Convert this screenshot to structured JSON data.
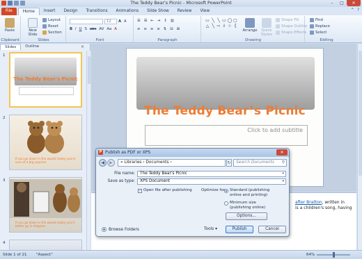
{
  "window": {
    "title": "The Teddy Bear's Picnic - Microsoft PowerPoint",
    "minimize": "–",
    "maximize": "□",
    "close": "✕"
  },
  "tabs": [
    "File",
    "Home",
    "Insert",
    "Design",
    "Transitions",
    "Animations",
    "Slide Show",
    "Review",
    "View"
  ],
  "ribbon": {
    "clipboard": {
      "label": "Clipboard",
      "paste": "Paste"
    },
    "slides": {
      "label": "Slides",
      "new_slide": "New Slide",
      "layout": "Layout",
      "reset": "Reset",
      "section": "Section"
    },
    "font": {
      "label": "Font",
      "size": "12"
    },
    "paragraph": {
      "label": "Paragraph"
    },
    "drawing": {
      "label": "Drawing",
      "arrange": "Arrange",
      "quick_styles": "Quick Styles",
      "shape_fill": "Shape Fill",
      "shape_outline": "Shape Outline",
      "shape_effects": "Shape Effects"
    },
    "editing": {
      "label": "Editing",
      "find": "Find",
      "replace": "Replace",
      "select": "Select"
    }
  },
  "left_pane": {
    "tabs": [
      "Slides",
      "Outline"
    ],
    "close": "×",
    "slides": [
      {
        "number": "1",
        "title": "The Teddy Bear's Picnic"
      },
      {
        "number": "2",
        "caption": "If you go down in the woods today you're sure of a big surprise"
      },
      {
        "number": "3",
        "caption": "If you go down in the woods today you'd better go in disguise"
      },
      {
        "number": "4",
        "caption": ""
      }
    ]
  },
  "slide": {
    "title": "The Teddy Bear’s Picnic",
    "subtitle_placeholder": "Click to add subtitle"
  },
  "notes": {
    "link_text": "after Bratton",
    "line1_after": ", written in",
    "line2": "is a children's song, having"
  },
  "status": {
    "slide": "Slide 1 of 21",
    "theme": "\"Aspect\"",
    "zoom": "64%"
  },
  "dialog": {
    "title": "Publish as PDF or XPS",
    "breadcrumb": "« Libraries › Documents ›",
    "search_placeholder": "Search Documents",
    "file_name_label": "File name:",
    "file_name_value": "The Teddy Bear's Picnic",
    "save_type_label": "Save as type:",
    "save_type_value": "XPS Document",
    "open_after_label": "Open file after publishing",
    "open_after_checked": true,
    "optimize_label": "Optimize for:",
    "standard_option": "Standard (publishing online and printing)",
    "minimum_option": "Minimum size (publishing online)",
    "optimize_selected": "standard",
    "options_button": "Options...",
    "browse_folders": "Browse Folders",
    "tools": "Tools",
    "publish_button": "Publish",
    "cancel_button": "Cancel"
  },
  "colors": {
    "file_tab": "#d24726",
    "title_orange": "#ee7c33",
    "ribbon_bg": "#dde8f5"
  }
}
